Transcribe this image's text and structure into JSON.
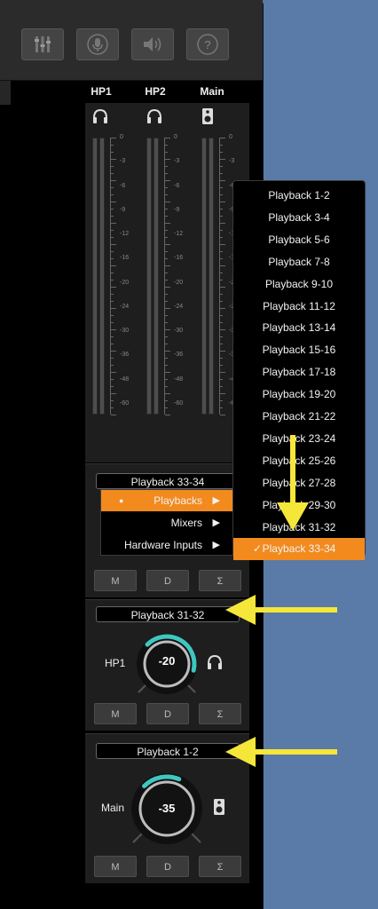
{
  "toolbar": {
    "buttons": [
      {
        "icon": "mixer-faders-icon"
      },
      {
        "icon": "microphone-icon"
      },
      {
        "icon": "speaker-volume-icon"
      },
      {
        "icon": "help-icon",
        "label": "?"
      }
    ]
  },
  "columns": [
    {
      "label": "HP1",
      "icon": "headphones-icon"
    },
    {
      "label": "HP2",
      "icon": "headphones-icon"
    },
    {
      "label": "Main",
      "icon": "speaker-icon"
    }
  ],
  "meter_scale": [
    "0",
    "-3",
    "-6",
    "-9",
    "-12",
    "-16",
    "-20",
    "-24",
    "-30",
    "-36",
    "-48",
    "-60"
  ],
  "strips": {
    "hp2": {
      "source": "Playback 33-34",
      "buttons": [
        "M",
        "D",
        "Σ"
      ]
    },
    "hp1": {
      "source": "Playback 31-32",
      "label": "HP1",
      "value": "-20",
      "level_fraction": 0.55,
      "buttons": [
        "M",
        "D",
        "Σ"
      ]
    },
    "main": {
      "source": "Playback 1-2",
      "label": "Main",
      "value": "-35",
      "level_fraction": 0.25,
      "buttons": [
        "M",
        "D",
        "Σ"
      ]
    }
  },
  "source_menu": {
    "items": [
      "Playbacks",
      "Mixers",
      "Hardware Inputs"
    ],
    "selected": "Playbacks"
  },
  "playback_menu": {
    "items": [
      "Playback 1-2",
      "Playback 3-4",
      "Playback 5-6",
      "Playback 7-8",
      "Playback 9-10",
      "Playback 11-12",
      "Playback 13-14",
      "Playback 15-16",
      "Playback 17-18",
      "Playback 19-20",
      "Playback 21-22",
      "Playback 23-24",
      "Playback 25-26",
      "Playback 27-28",
      "Playback 29-30",
      "Playback 31-32",
      "Playback 33-34"
    ],
    "selected": "Playback 33-34"
  },
  "colors": {
    "accent": "#f28a1e",
    "knob_ring": "#3ec7c0",
    "annotation_arrow": "#f5e63a",
    "background": "#5a7aa7"
  }
}
